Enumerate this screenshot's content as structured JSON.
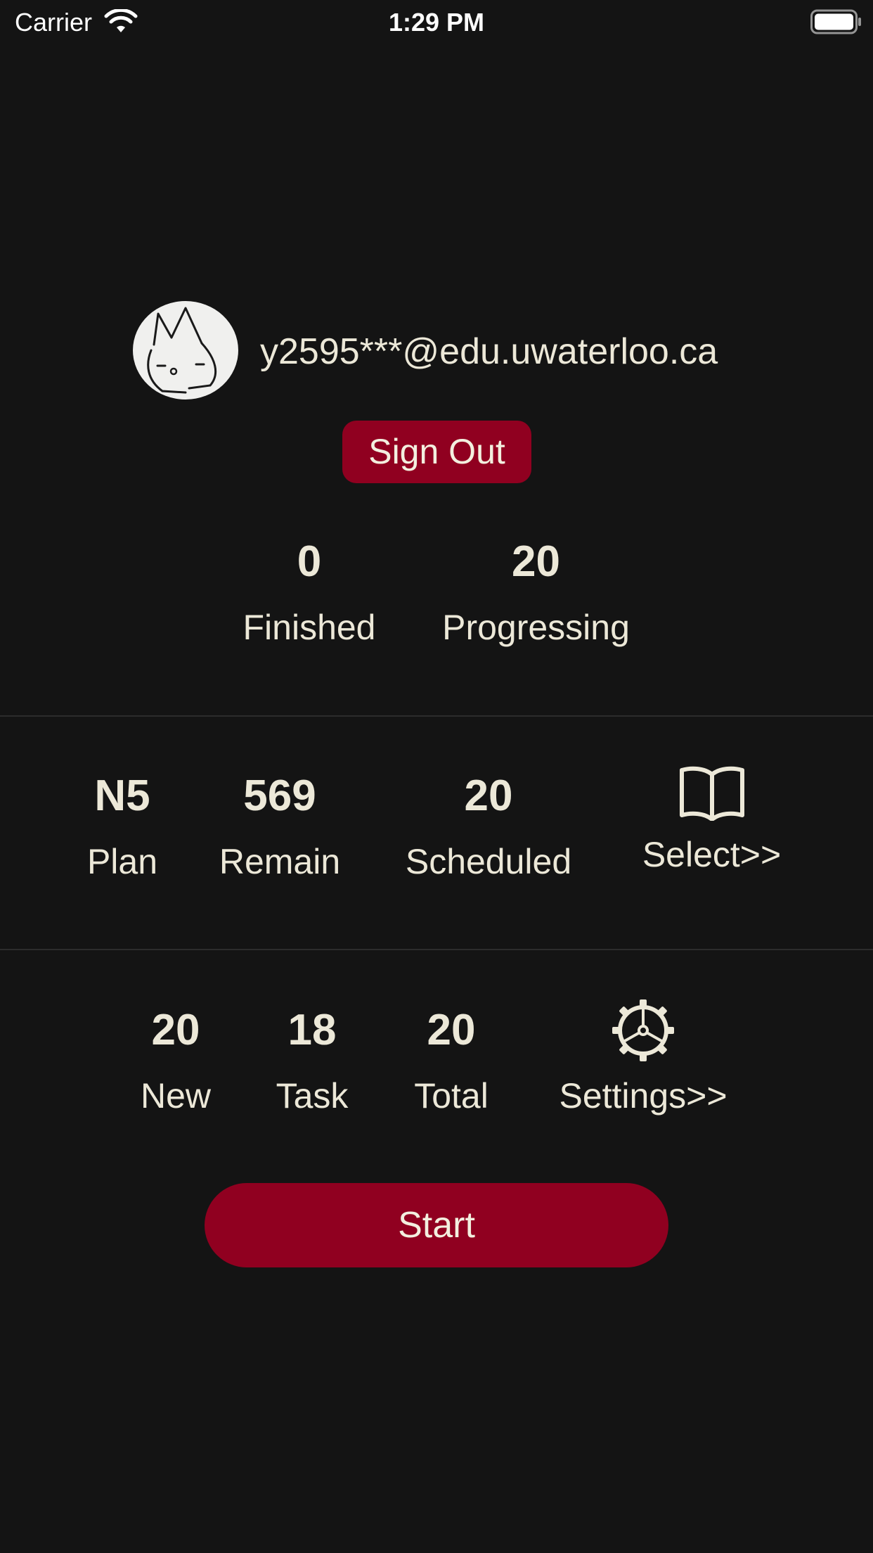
{
  "status_bar": {
    "carrier": "Carrier",
    "time": "1:29 PM",
    "wifi_icon": "wifi-icon",
    "battery_icon": "battery-full-icon"
  },
  "profile": {
    "avatar_icon": "cat-sketch-avatar",
    "email": "y2595***@edu.uwaterloo.ca",
    "sign_out_label": "Sign Out"
  },
  "progress": {
    "finished_value": "0",
    "finished_label": "Finished",
    "progressing_value": "20",
    "progressing_label": "Progressing"
  },
  "plan": {
    "plan_value": "N5",
    "plan_label": "Plan",
    "remain_value": "569",
    "remain_label": "Remain",
    "scheduled_value": "20",
    "scheduled_label": "Scheduled",
    "select_icon": "book-icon",
    "select_label": "Select>>"
  },
  "session": {
    "new_value": "20",
    "new_label": "New",
    "task_value": "18",
    "task_label": "Task",
    "total_value": "20",
    "total_label": "Total",
    "settings_icon": "gear-icon",
    "settings_label": "Settings>>"
  },
  "start_label": "Start",
  "colors": {
    "background": "#141414",
    "accent": "#900020",
    "text": "#ece8d8",
    "divider": "#2c2c2c"
  }
}
